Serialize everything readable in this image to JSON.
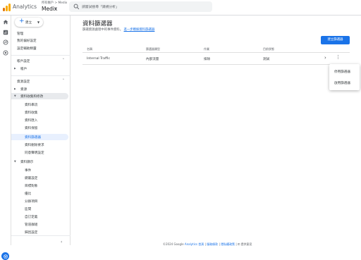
{
  "header": {
    "app_name": "Analytics",
    "account_path": "所有帳戶 > Medix",
    "property_name": "Medix",
    "search_placeholder": "請嘗試搜尋「識規分析」"
  },
  "nav": {
    "create_label": "建立",
    "top_items": [
      "管理",
      "我的偏好設定",
      "設定輔助精靈"
    ],
    "account_section": {
      "title": "帳戶設定",
      "items": [
        "帳戶"
      ]
    },
    "property_section": {
      "title": "資源設定",
      "items": [
        "資源",
        "資料收集和修改"
      ],
      "sub_items": [
        "資料串流",
        "資料收集",
        "資料匯入",
        "資料保留",
        "資料篩選器",
        "資料刪除要求",
        "同意聲明設定"
      ]
    },
    "display_section": {
      "title": "資料顯示",
      "sub_items": [
        "事件",
        "鍵屬設定",
        "目標對象",
        "優比",
        "分群項目",
        "區間",
        "自訂定義",
        "管道群組",
        "歸因設定"
      ]
    }
  },
  "main": {
    "title": "資料篩選器",
    "subtitle": "篩選資源處理中的事件資料。",
    "learn_more": "進一步瞭解資料篩選器",
    "create_button": "建立篩選器",
    "columns": [
      "名稱",
      "篩選器類型",
      "作業",
      "目前狀態"
    ],
    "rows": [
      {
        "name": "Internal Traffic",
        "type": "內部流量",
        "operation": "排除",
        "status": "測試"
      }
    ],
    "menu_items": [
      "停用篩選器",
      "啟用篩選器"
    ]
  },
  "footer": {
    "copyright": "©2024 Google",
    "links": [
      "Analytics 首頁",
      "服務條款",
      "隱私權政策"
    ],
    "feedback": "提供意見"
  },
  "colors": {
    "accent": "#1a73e8",
    "logo": "#f9ab00",
    "selected_bg": "#e8f0fe"
  }
}
